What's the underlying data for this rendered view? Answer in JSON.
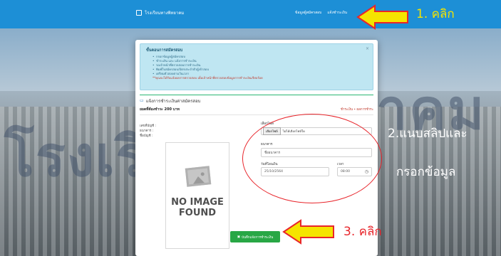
{
  "background": {
    "watermark_left": "โรงเรีย",
    "watermark_right": "าคม"
  },
  "navbar": {
    "brand": "โรงเรียนทางพิทยาคม",
    "links": [
      "ข้อมูลผู้สมัครสอบ",
      "แจ้งชำระเงิน"
    ]
  },
  "modal": {
    "info": {
      "title": "ขั้นตอนการสมัครสอบ",
      "steps": [
        "กรอกข้อมูลผู้สมัครสอบ",
        "ชำระเงิน และ แจ้งการชำระเงิน",
        "รอเจ้าหน้าที่ตรวจสอบการชำระเงิน",
        "พิมพ์ใบสมัครสอบ/บัตรประจำตัวผู้เข้าสอบ",
        "เตรียมตัวสอบตามวันเวลา"
      ],
      "note": "**คุณจะได้รับแจ้งผลการตรวจสอบ เมื่อเจ้าหน้าที่ตรวจสอบข้อมูลการชำระเงินเรียบร้อย",
      "close": "×"
    },
    "section_title": "แจ้งการชำระเงินค่าสมัครสอบ",
    "amount_label": "ยอดที่ต้องชำระ 200 บาท",
    "amount_right": "ชำระเงิน • ผลการชำระ",
    "left_labels": [
      "เลขที่บัญชี :",
      "ธนาคาร :",
      "ชื่อบัญชี :"
    ],
    "no_image": [
      "NO IMAGE",
      "FOUND"
    ],
    "form": {
      "file_label": "เลือกไฟล์",
      "file_button": "เลือกไฟล์",
      "file_status": "ไม่ได้เลือกไฟล์ใด",
      "bank_label": "ธนาคาร",
      "bank_value": "ชื่อธนาคาร",
      "date_label": "วันที่โอนเงิน",
      "date_value": "25/10/2564",
      "time_label": "เวลา",
      "time_value": "08:00"
    },
    "save_button": "บันทึกแจ้งการชำระเงิน"
  },
  "annotations": {
    "step1": "1. คลิก",
    "step2_line1": "2.แนบสลิปและ",
    "step2_line2": "กรอกข้อมูล",
    "step3": "3. คลิก",
    "arrow_color": "#f5e400",
    "circle_color": "#e8252b"
  }
}
